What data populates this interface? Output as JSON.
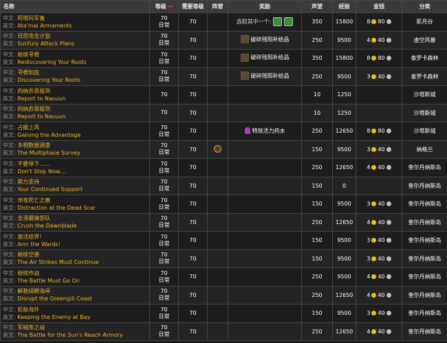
{
  "columns": {
    "name": "名称",
    "level": "等级",
    "sort_mark": "↔",
    "req_level": "需要等级",
    "camp": "阵营",
    "reward": "奖励",
    "rep": "声望",
    "xp": "经验",
    "money": "金钱",
    "category": "分类"
  },
  "labels": {
    "zh": "中文:",
    "en": "英文:"
  },
  "rows": [
    {
      "zh": "阿塔玛军备",
      "en": "Ata'mal Armaments",
      "level": "70",
      "type": "日常",
      "req": "70",
      "reward_text": "选取其中一个:",
      "reward_icon": "green-icons",
      "rep": "350",
      "xp": "15800",
      "gold": "8",
      "silver": "80",
      "category": "影月谷"
    },
    {
      "zh": "日怒攻击计划",
      "en": "Sunfury Attack Plans",
      "level": "70",
      "type": "日常",
      "req": "70",
      "reward_text": "破碎残阳补给品",
      "reward_icon": "box-icon",
      "rep": "250",
      "xp": "9500",
      "gold": "4",
      "silver": "40",
      "category": "虚空风暴"
    },
    {
      "zh": "继续寻根",
      "en": "Rediscovering Your Roots",
      "level": "70",
      "type": "日常",
      "req": "70",
      "reward_text": "破碎残阳补给品",
      "reward_icon": "box-icon",
      "rep": "350",
      "xp": "15800",
      "gold": "8",
      "silver": "80",
      "category": "泰罗卡森林"
    },
    {
      "zh": "寻根知底",
      "en": "Discovering Your Roots",
      "level": "70",
      "type": "日常",
      "req": "70",
      "reward_text": "破碎残阳补给品",
      "reward_icon": "box-icon",
      "rep": "250",
      "xp": "9500",
      "gold": "3",
      "silver": "40",
      "category": "泰罗卡森林"
    },
    {
      "zh": "向纳苏恩报到",
      "en": "Report to Nasuun",
      "level": "70",
      "type": "",
      "req": "70",
      "reward_text": "",
      "reward_icon": "",
      "rep": "10",
      "xp": "1250",
      "gold": "",
      "silver": "",
      "category": "沙塔斯城"
    },
    {
      "zh": "向纳苏恩报到",
      "en": "Report to Nasuun",
      "level": "70",
      "type": "",
      "req": "70",
      "reward_text": "",
      "reward_icon": "",
      "rep": "10",
      "xp": "1250",
      "gold": "",
      "silver": "",
      "category": "沙塔斯城"
    },
    {
      "zh": "占据上风",
      "en": "Gaining the Advantage",
      "level": "70",
      "type": "日常",
      "req": "70",
      "reward_text": "特效活力药水",
      "reward_icon": "potion-icon",
      "rep": "250",
      "xp": "12650",
      "gold": "8",
      "silver": "80",
      "category": "沙塔斯城"
    },
    {
      "zh": "多相数据调查",
      "en": "The Multiphase Survey",
      "level": "70",
      "type": "日常",
      "req": "70",
      "reward_text": "",
      "reward_icon": "faction-icon",
      "rep": "150",
      "xp": "9500",
      "gold": "3",
      "silver": "40",
      "category": "纳格兰"
    },
    {
      "zh": "不要停下……",
      "en": "Don't Stop Now....",
      "level": "70",
      "type": "日常",
      "req": "70",
      "reward_text": "",
      "reward_icon": "",
      "rep": "250",
      "xp": "12650",
      "gold": "4",
      "silver": "40",
      "category": "奎尔丹纳斯岛"
    },
    {
      "zh": "鼎力支持",
      "en": "Your Continued Support",
      "level": "70",
      "type": "日常",
      "req": "70",
      "reward_text": "",
      "reward_icon": "",
      "rep": "150",
      "xp": "0",
      "gold": "",
      "silver": "",
      "category": "奎尔丹纳斯岛"
    },
    {
      "zh": "佯攻死亡之痕",
      "en": "Distraction at the Dead Scar",
      "level": "70",
      "type": "日常",
      "req": "70",
      "reward_text": "",
      "reward_icon": "",
      "rep": "150",
      "xp": "9500",
      "gold": "3",
      "silver": "40",
      "category": "奎尔丹纳斯岛"
    },
    {
      "zh": "击溃晨锋部队",
      "en": "Crush the Dawnblade",
      "level": "70",
      "type": "日常",
      "req": "70",
      "reward_text": "",
      "reward_icon": "",
      "rep": "250",
      "xp": "12650",
      "gold": "4",
      "silver": "40",
      "category": "奎尔丹纳斯岛"
    },
    {
      "zh": "激活结界!",
      "en": "Arm the Wards!",
      "level": "70",
      "type": "日常",
      "req": "70",
      "reward_text": "",
      "reward_icon": "",
      "rep": "150",
      "xp": "9500",
      "gold": "3",
      "silver": "40",
      "category": "奎尔丹纳斯岛"
    },
    {
      "zh": "继续空袭",
      "en": "The Air Strikes Must Continue",
      "level": "70",
      "type": "日常",
      "req": "70",
      "reward_text": "",
      "reward_icon": "",
      "rep": "150",
      "xp": "9500",
      "gold": "3",
      "silver": "40",
      "category": "奎尔丹纳斯岛"
    },
    {
      "zh": "继续作战",
      "en": "The Battle Must Go On",
      "level": "70",
      "type": "日常",
      "req": "70",
      "reward_text": "",
      "reward_icon": "",
      "rep": "250",
      "xp": "9500",
      "gold": "4",
      "silver": "40",
      "category": "奎尔丹纳斯岛"
    },
    {
      "zh": "解救绿鳃海岸",
      "en": "Disrupt the Greengill Coast",
      "level": "70",
      "type": "日常",
      "req": "70",
      "reward_text": "",
      "reward_icon": "",
      "rep": "250",
      "xp": "12650",
      "gold": "4",
      "silver": "40",
      "category": "奎尔丹纳斯岛"
    },
    {
      "zh": "拒敌海外",
      "en": "Keeping the Enemy at Bay",
      "level": "70",
      "type": "日常",
      "req": "70",
      "reward_text": "",
      "reward_icon": "",
      "rep": "150",
      "xp": "9500",
      "gold": "3",
      "silver": "40",
      "category": "奎尔丹纳斯岛"
    },
    {
      "zh": "军械库之战",
      "en": "The Battle for the Sun's Reach Armory",
      "level": "70",
      "type": "日常",
      "req": "70",
      "reward_text": "",
      "reward_icon": "",
      "rep": "250",
      "xp": "12650",
      "gold": "4",
      "silver": "40",
      "category": "奎尔丹纳斯岛"
    }
  ]
}
